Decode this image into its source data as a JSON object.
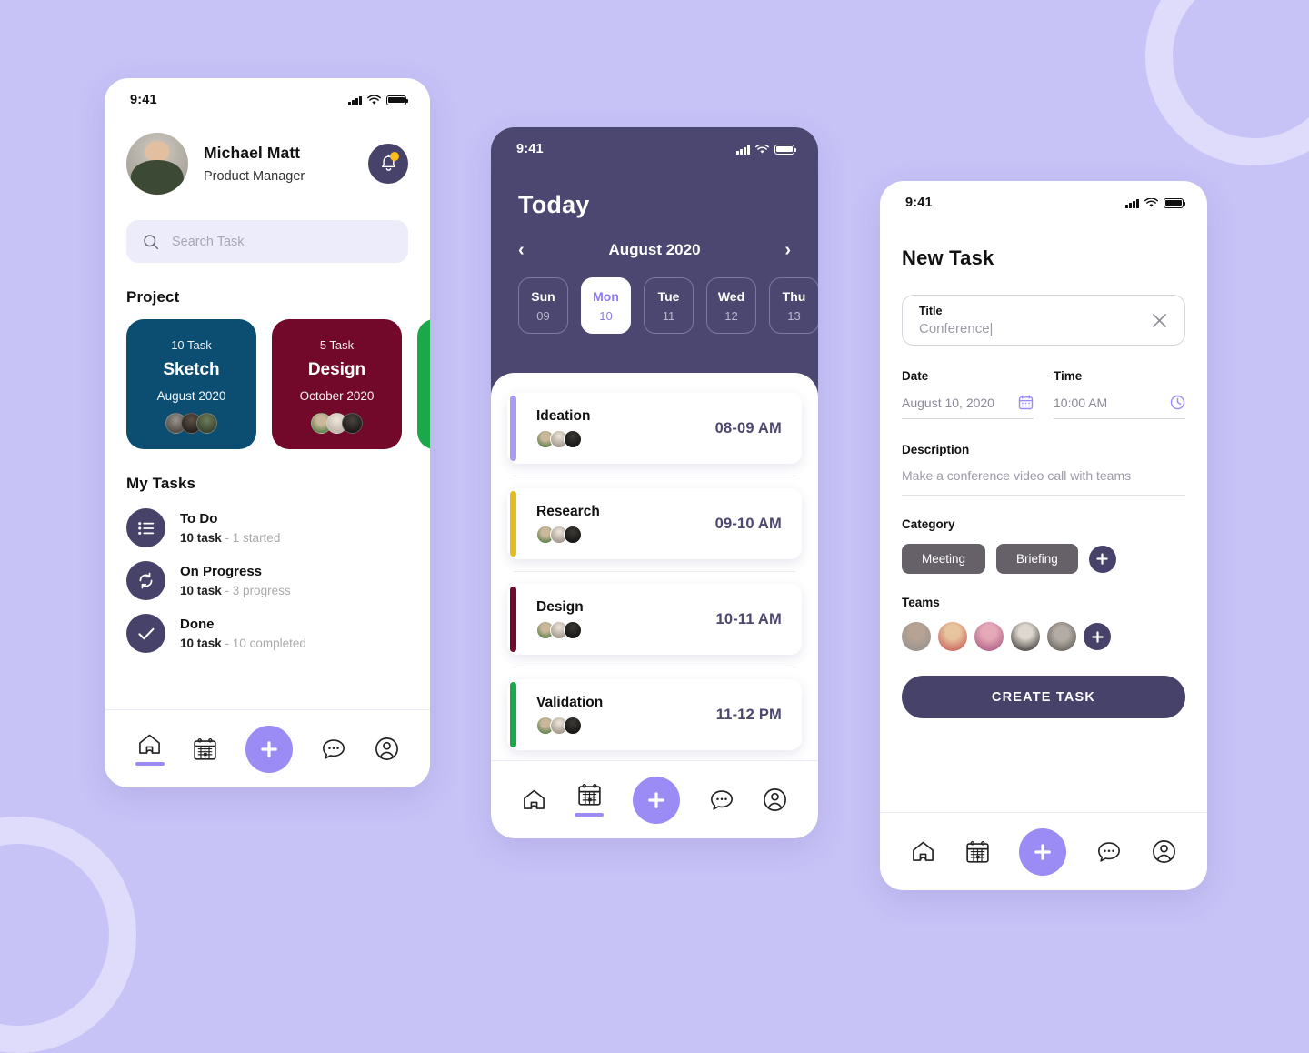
{
  "background": {
    "color": "#c7c3f7",
    "ring_color": "#dedcfa"
  },
  "theme": {
    "primary": "#474269",
    "accent": "#9b8cf5",
    "dark_panel": "#4c4770"
  },
  "phone1": {
    "status": {
      "time": "9:41"
    },
    "profile": {
      "name": "Michael Matt",
      "role": "Product Manager"
    },
    "notification": {
      "icon": "bell-icon",
      "has_badge": true
    },
    "search": {
      "placeholder": "Search Task",
      "icon": "search-icon"
    },
    "section_project": "Project",
    "projects": [
      {
        "count": "10 Task",
        "name": "Sketch",
        "date": "August 2020",
        "color": "#0b4e72",
        "members": 3
      },
      {
        "count": "5 Task",
        "name": "Design",
        "date": "October 2020",
        "color": "#72092a",
        "members": 3
      },
      {
        "count": "",
        "name": "",
        "date": "",
        "color": "#1aa84a",
        "members": 0
      }
    ],
    "section_tasks": "My Tasks",
    "tasks": [
      {
        "icon": "list-icon",
        "name": "To Do",
        "count": "10 task",
        "sep": " - ",
        "status": "1 started"
      },
      {
        "icon": "refresh-icon",
        "name": "On Progress",
        "count": "10 task",
        "sep": " - ",
        "status": "3 progress"
      },
      {
        "icon": "check-icon",
        "name": "Done",
        "count": "10 task",
        "sep": " - ",
        "status": "10 completed"
      }
    ],
    "tabs": [
      {
        "icon": "home-icon",
        "active": true
      },
      {
        "icon": "calendar-icon",
        "active": false
      },
      {
        "icon": "plus-icon",
        "active": false
      },
      {
        "icon": "chat-icon",
        "active": false
      },
      {
        "icon": "profile-icon",
        "active": false
      }
    ]
  },
  "phone2": {
    "status": {
      "time": "9:41"
    },
    "heading": "Today",
    "month": "August 2020",
    "prev_icon": "chevron-left-icon",
    "next_icon": "chevron-right-icon",
    "days": [
      {
        "weekday": "Sun",
        "number": "09",
        "active": false
      },
      {
        "weekday": "Mon",
        "number": "10",
        "active": true
      },
      {
        "weekday": "Tue",
        "number": "11",
        "active": false
      },
      {
        "weekday": "Wed",
        "number": "12",
        "active": false
      },
      {
        "weekday": "Thu",
        "number": "13",
        "active": false
      }
    ],
    "events": [
      {
        "name": "Ideation",
        "time": "08-09 AM",
        "color": "#a99bf3",
        "members": 3
      },
      {
        "name": "Research",
        "time": "09-10 AM",
        "color": "#e3bc1e",
        "members": 3
      },
      {
        "name": "Design",
        "time": "10-11 AM",
        "color": "#72092a",
        "members": 3
      },
      {
        "name": "Validation",
        "time": "11-12 PM",
        "color": "#1aa84a",
        "members": 3
      }
    ],
    "tabs": [
      {
        "icon": "home-icon",
        "active": false
      },
      {
        "icon": "calendar-icon",
        "active": true
      },
      {
        "icon": "plus-icon",
        "active": false
      },
      {
        "icon": "chat-icon",
        "active": false
      },
      {
        "icon": "profile-icon",
        "active": false
      }
    ]
  },
  "phone3": {
    "status": {
      "time": "9:41"
    },
    "heading": "New Task",
    "title_field": {
      "label": "Title",
      "value": "Conference|",
      "clear_icon": "close-icon"
    },
    "date_field": {
      "label": "Date",
      "value": "August 10, 2020",
      "icon": "calendar-icon"
    },
    "time_field": {
      "label": "Time",
      "value": "10:00 AM",
      "icon": "clock-icon"
    },
    "description": {
      "label": "Description",
      "value": "Make a conference video call with teams"
    },
    "category": {
      "label": "Category",
      "chips": [
        "Meeting",
        "Briefing"
      ],
      "add_icon": "plus-icon"
    },
    "teams": {
      "label": "Teams",
      "count": 5,
      "add_icon": "plus-icon"
    },
    "cta": "CREATE TASK",
    "tabs": [
      {
        "icon": "home-icon",
        "active": false
      },
      {
        "icon": "calendar-icon",
        "active": false
      },
      {
        "icon": "plus-icon",
        "active": false
      },
      {
        "icon": "chat-icon",
        "active": false
      },
      {
        "icon": "profile-icon",
        "active": false
      }
    ]
  }
}
